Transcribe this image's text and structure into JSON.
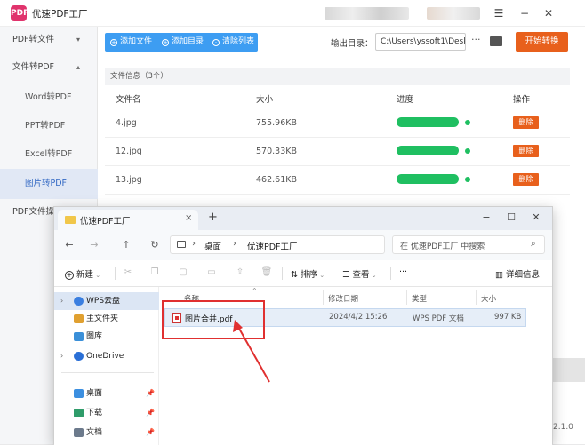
{
  "app": {
    "title": "优速PDF工厂",
    "logo_text": "PDF",
    "sidebar": {
      "items": [
        {
          "label": "PDF转文件",
          "chevron": "⌄"
        },
        {
          "label": "文件转PDF",
          "chevron": "⌃"
        },
        {
          "label": "Word转PDF"
        },
        {
          "label": "PPT转PDF"
        },
        {
          "label": "Excel转PDF"
        },
        {
          "label": "图片转PDF"
        },
        {
          "label": "PDF文件操"
        }
      ]
    },
    "toolbar": {
      "add_file": "添加文件",
      "add_dir": "添加目录",
      "clear_list": "清除列表",
      "output_label": "输出目录：",
      "output_path": "C:\\Users\\yssoft1\\Deskt",
      "more": "···",
      "start": "开始转换"
    },
    "file_panel": {
      "info_bar": "文件信息（3个）",
      "columns": [
        "文件名",
        "大小",
        "进度",
        "操作"
      ],
      "rows": [
        {
          "name": "4.jpg",
          "size": "755.96KB",
          "progress": 1.0,
          "action": "删除"
        },
        {
          "name": "12.jpg",
          "size": "570.33KB",
          "progress": 1.0,
          "action": "删除"
        },
        {
          "name": "13.jpg",
          "size": "462.61KB",
          "progress": 1.0,
          "action": "删除"
        }
      ]
    },
    "version": "2.1.0",
    "colors": {
      "accent_blue": "#3d9df2",
      "orange": "#e8601c",
      "green": "#1fbf61"
    }
  },
  "explorer": {
    "tab_title": "优速PDF工厂",
    "tab_close": "×",
    "new_tab": "+",
    "address": {
      "seg1": "桌面",
      "seg2": "优速PDF工厂"
    },
    "search_placeholder": "在 优速PDF工厂 中搜索",
    "cmdbar": {
      "new": "新建",
      "sort": "排序",
      "view": "查看",
      "more": "···",
      "details": "详细信息"
    },
    "nav": [
      {
        "label": "WPS云盘",
        "chevron": "›",
        "icon": "cloud-icon"
      },
      {
        "label": "主文件夹",
        "icon": "home-icon"
      },
      {
        "label": "图库",
        "icon": "gallery-icon"
      },
      {
        "label": "OneDrive",
        "chevron": "›",
        "icon": "onedrive-icon"
      },
      {
        "label": "桌面",
        "icon": "desktop-icon",
        "pinned": true
      },
      {
        "label": "下载",
        "icon": "download-icon",
        "pinned": true
      },
      {
        "label": "文档",
        "icon": "document-icon",
        "pinned": true
      }
    ],
    "columns": [
      "名称",
      "修改日期",
      "类型",
      "大小"
    ],
    "files": [
      {
        "name": "图片合并.pdf",
        "modified": "2024/4/2 15:26",
        "type": "WPS PDF 文档",
        "size": "997 KB"
      }
    ]
  }
}
